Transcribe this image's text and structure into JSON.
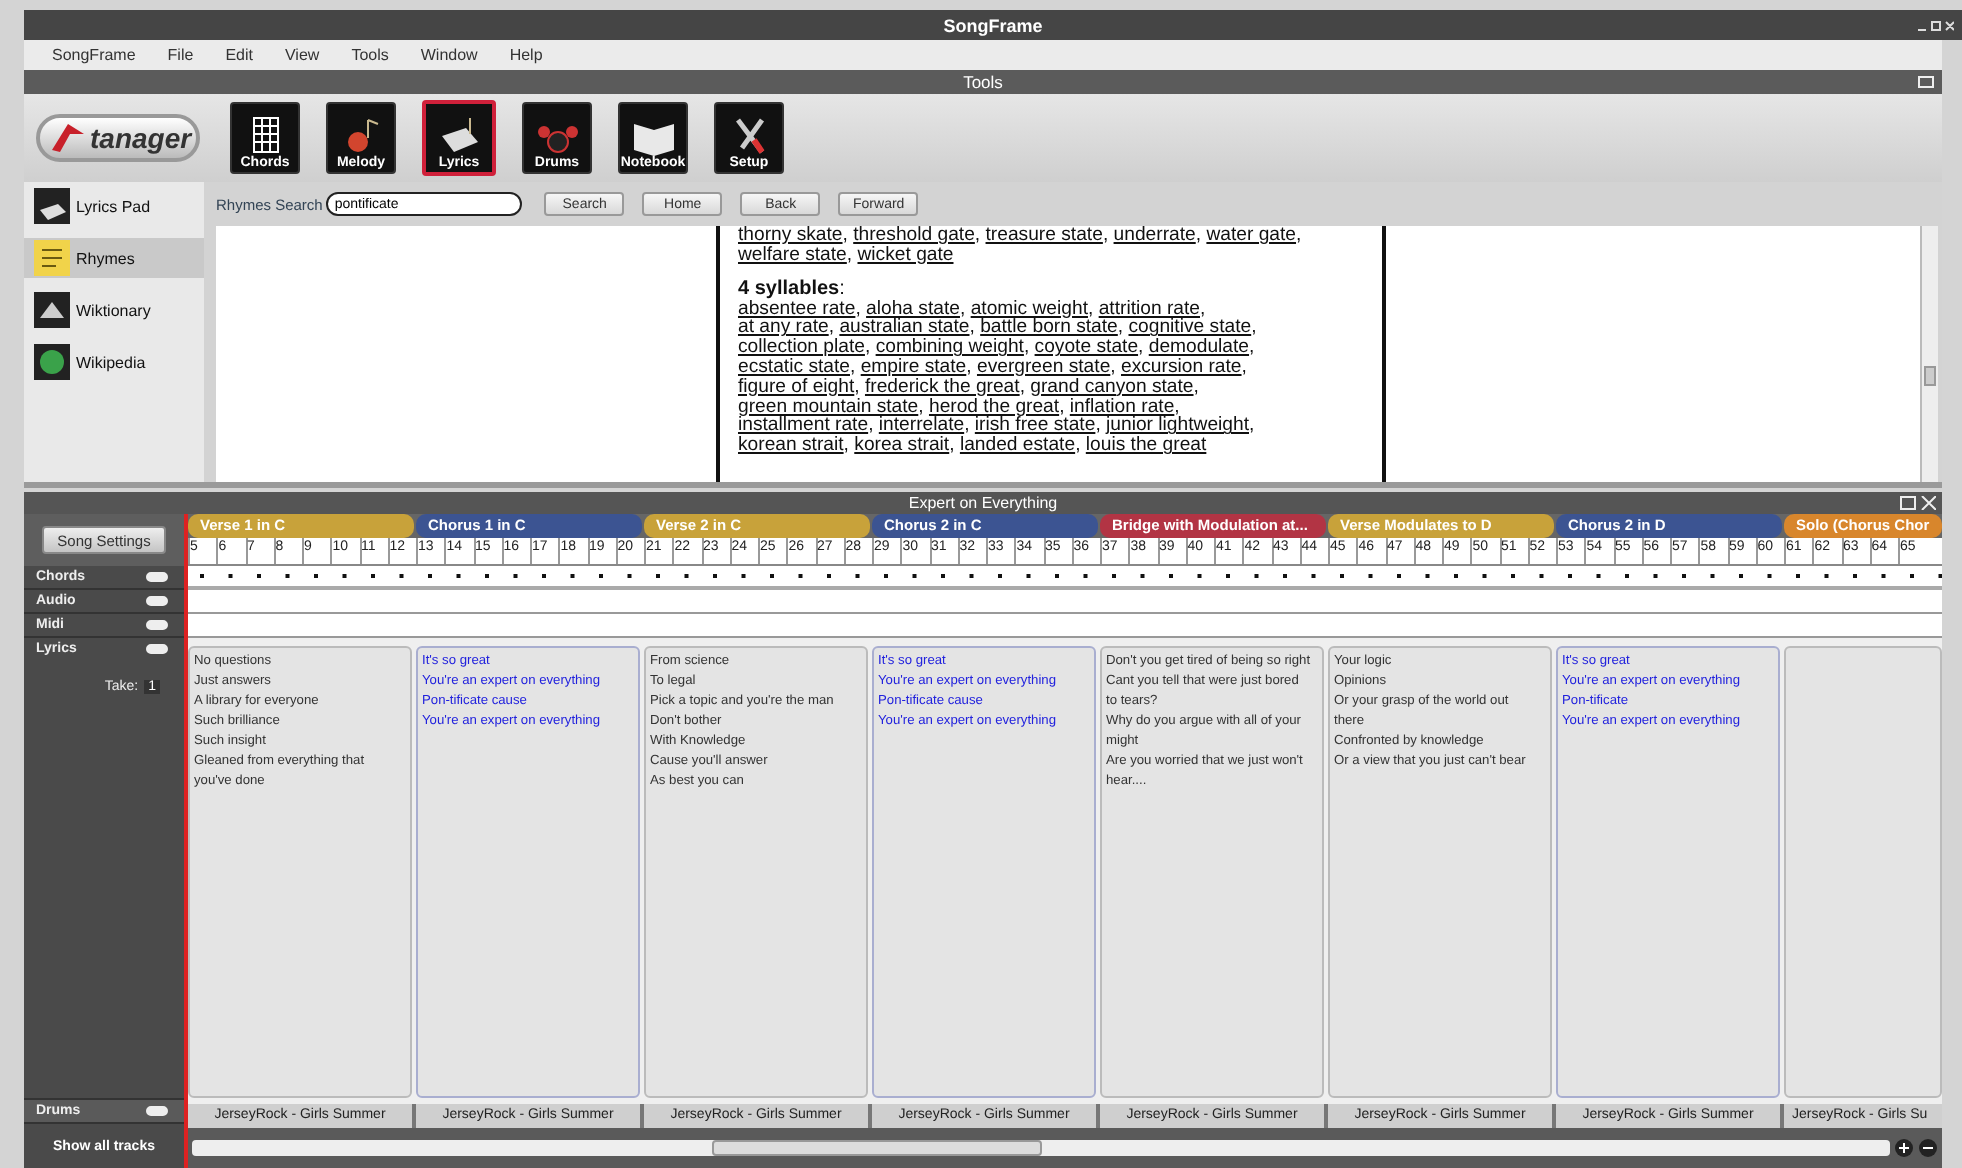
{
  "window": {
    "title": "SongFrame"
  },
  "menu": [
    "SongFrame",
    "File",
    "Edit",
    "View",
    "Tools",
    "Window",
    "Help"
  ],
  "tools_panel": {
    "title": "Tools",
    "logo": "tanager",
    "tools": [
      {
        "label": "Chords",
        "selected": false
      },
      {
        "label": "Melody",
        "selected": false
      },
      {
        "label": "Lyrics",
        "selected": true
      },
      {
        "label": "Drums",
        "selected": false
      },
      {
        "label": "Notebook",
        "selected": false
      },
      {
        "label": "Setup",
        "selected": false
      }
    ]
  },
  "sidebar": {
    "items": [
      {
        "label": "Lyrics Pad",
        "selected": false
      },
      {
        "label": "Rhymes",
        "selected": true
      },
      {
        "label": "Wiktionary",
        "selected": false
      },
      {
        "label": "Wikipedia",
        "selected": false
      }
    ]
  },
  "rhymes": {
    "search_label": "Rhymes Search",
    "search_value": "pontificate",
    "buttons": [
      "Search",
      "Home",
      "Back",
      "Forward"
    ],
    "lines_before": [
      [
        {
          "text": "thorny skate",
          "punct": ","
        },
        {
          "text": "threshold gate",
          "punct": ","
        },
        {
          "text": "treasure state",
          "punct": ","
        },
        {
          "text": "underrate",
          "punct": ","
        },
        {
          "text": "water gate",
          "punct": ","
        }
      ],
      [
        {
          "text": "welfare state",
          "punct": ","
        },
        {
          "text": "wicket gate"
        }
      ]
    ],
    "heading": "**4 syllables**:",
    "lines_after": [
      [
        {
          "text": "absentee rate",
          "punct": ","
        },
        {
          "text": "aloha state",
          "punct": ","
        },
        {
          "text": "atomic weight",
          "punct": ","
        },
        {
          "text": "attrition rate",
          "punct": ","
        }
      ],
      [
        {
          "text": "at any rate",
          "punct": ","
        },
        {
          "text": "australian state",
          "punct": ","
        },
        {
          "text": "battle born state",
          "punct": ","
        },
        {
          "text": "cognitive state",
          "punct": ","
        }
      ],
      [
        {
          "text": "collection plate",
          "punct": ","
        },
        {
          "text": "combining weight",
          "punct": ","
        },
        {
          "text": "coyote state",
          "punct": ","
        },
        {
          "text": "demodulate",
          "punct": ","
        }
      ],
      [
        {
          "text": "ecstatic state",
          "punct": ","
        },
        {
          "text": "empire state",
          "punct": ","
        },
        {
          "text": "evergreen state",
          "punct": ","
        },
        {
          "text": "excursion rate",
          "punct": ","
        }
      ],
      [
        {
          "text": "figure of eight",
          "punct": ","
        },
        {
          "text": "frederick the great",
          "punct": ","
        },
        {
          "text": "grand canyon state",
          "punct": ","
        }
      ],
      [
        {
          "text": "green mountain state",
          "punct": ","
        },
        {
          "text": "herod the great",
          "punct": ","
        },
        {
          "text": "inflation rate",
          "punct": ","
        }
      ],
      [
        {
          "text": "installment rate",
          "punct": ","
        },
        {
          "text": "interrelate",
          "punct": ","
        },
        {
          "text": "irish free state",
          "punct": ","
        },
        {
          "text": "junior lightweight",
          "punct": ","
        }
      ],
      [
        {
          "text": "korean strait",
          "punct": ","
        },
        {
          "text": "korea strait",
          "punct": ","
        },
        {
          "text": "landed estate",
          "punct": ","
        },
        {
          "text": "louis the great"
        }
      ]
    ]
  },
  "song": {
    "title": "Expert on Everything",
    "settings_button": "Song Settings",
    "tracks": [
      {
        "label": "Chords",
        "on": true
      },
      {
        "label": "Audio",
        "on": true
      },
      {
        "label": "Midi",
        "on": true
      },
      {
        "label": "Lyrics",
        "on": true
      }
    ],
    "drums_on": true,
    "take_label": "Take:",
    "take_value": "1",
    "drums_label": "Drums",
    "show_all": "Show all tracks",
    "ruler": [
      "5",
      "6",
      "7",
      "8",
      "9",
      "10",
      "11",
      "12",
      "13",
      "14",
      "15",
      "16",
      "17",
      "18",
      "19",
      "20",
      "21",
      "22",
      "23",
      "24",
      "25",
      "26",
      "27",
      "28",
      "29",
      "30",
      "31",
      "32",
      "33",
      "34",
      "35",
      "36",
      "37",
      "38",
      "39",
      "40",
      "41",
      "42",
      "43",
      "44",
      "45",
      "46",
      "47",
      "48",
      "49",
      "50",
      "51",
      "52",
      "53",
      "54",
      "55",
      "56",
      "57",
      "58",
      "59",
      "60",
      "61",
      "62",
      "63",
      "64",
      "65"
    ],
    "sections": [
      {
        "name": "Verse 1 in C",
        "color": "#c8a23a",
        "linked": false,
        "drums": "JerseyRock - Girls Summer",
        "lyrics": [
          "No questions",
          "Just answers",
          "A library for everyone",
          "Such brilliance",
          "Such insight",
          "Gleaned from everything that",
          "you've done"
        ]
      },
      {
        "name": "Chorus 1 in C",
        "color": "#3c5492",
        "linked": true,
        "drums": "JerseyRock - Girls Summer",
        "lyrics": [
          "It's so great",
          "You're an expert on everything",
          "Pon-tificate cause",
          "You're an expert on everything"
        ]
      },
      {
        "name": "Verse 2 in C",
        "color": "#c8a23a",
        "linked": false,
        "drums": "JerseyRock - Girls Summer",
        "lyrics": [
          "From science",
          "To legal",
          "Pick a topic and you're the man",
          "Don't bother",
          "With Knowledge",
          "Cause you'll answer",
          "As best you can"
        ]
      },
      {
        "name": "Chorus 2 in C",
        "color": "#3c5492",
        "linked": true,
        "drums": "JerseyRock - Girls Summer",
        "lyrics": [
          "It's so great",
          "You're an expert on everything",
          "Pon-tificate cause",
          "You're an expert on everything"
        ]
      },
      {
        "name": "Bridge with Modulation at...",
        "color": "#b23444",
        "linked": false,
        "drums": "JerseyRock - Girls Summer",
        "lyrics": [
          "Don't you get tired of being so right",
          "Cant you tell that were just bored",
          "to tears?",
          "Why do you argue with all of your",
          "might",
          "Are you worried that we just won't",
          "hear...."
        ]
      },
      {
        "name": "Verse  Modulates to D",
        "color": "#c8a23a",
        "linked": false,
        "drums": "JerseyRock - Girls Summer",
        "lyrics": [
          "Your logic",
          "Opinions",
          "Or your grasp of the world out",
          "there",
          "Confronted by knowledge",
          "Or a view that you just can't bear"
        ]
      },
      {
        "name": "Chorus 2 in D",
        "color": "#3c5492",
        "linked": true,
        "drums": "JerseyRock - Girls Summer",
        "lyrics": [
          "It's so great",
          "You're an expert on everything",
          "Pon-tificate",
          "You're an expert on everything"
        ]
      },
      {
        "name": "Solo (Chorus Chor",
        "color": "#d8862c",
        "linked": false,
        "drums": "JerseyRock - Girls Su"
      }
    ]
  }
}
